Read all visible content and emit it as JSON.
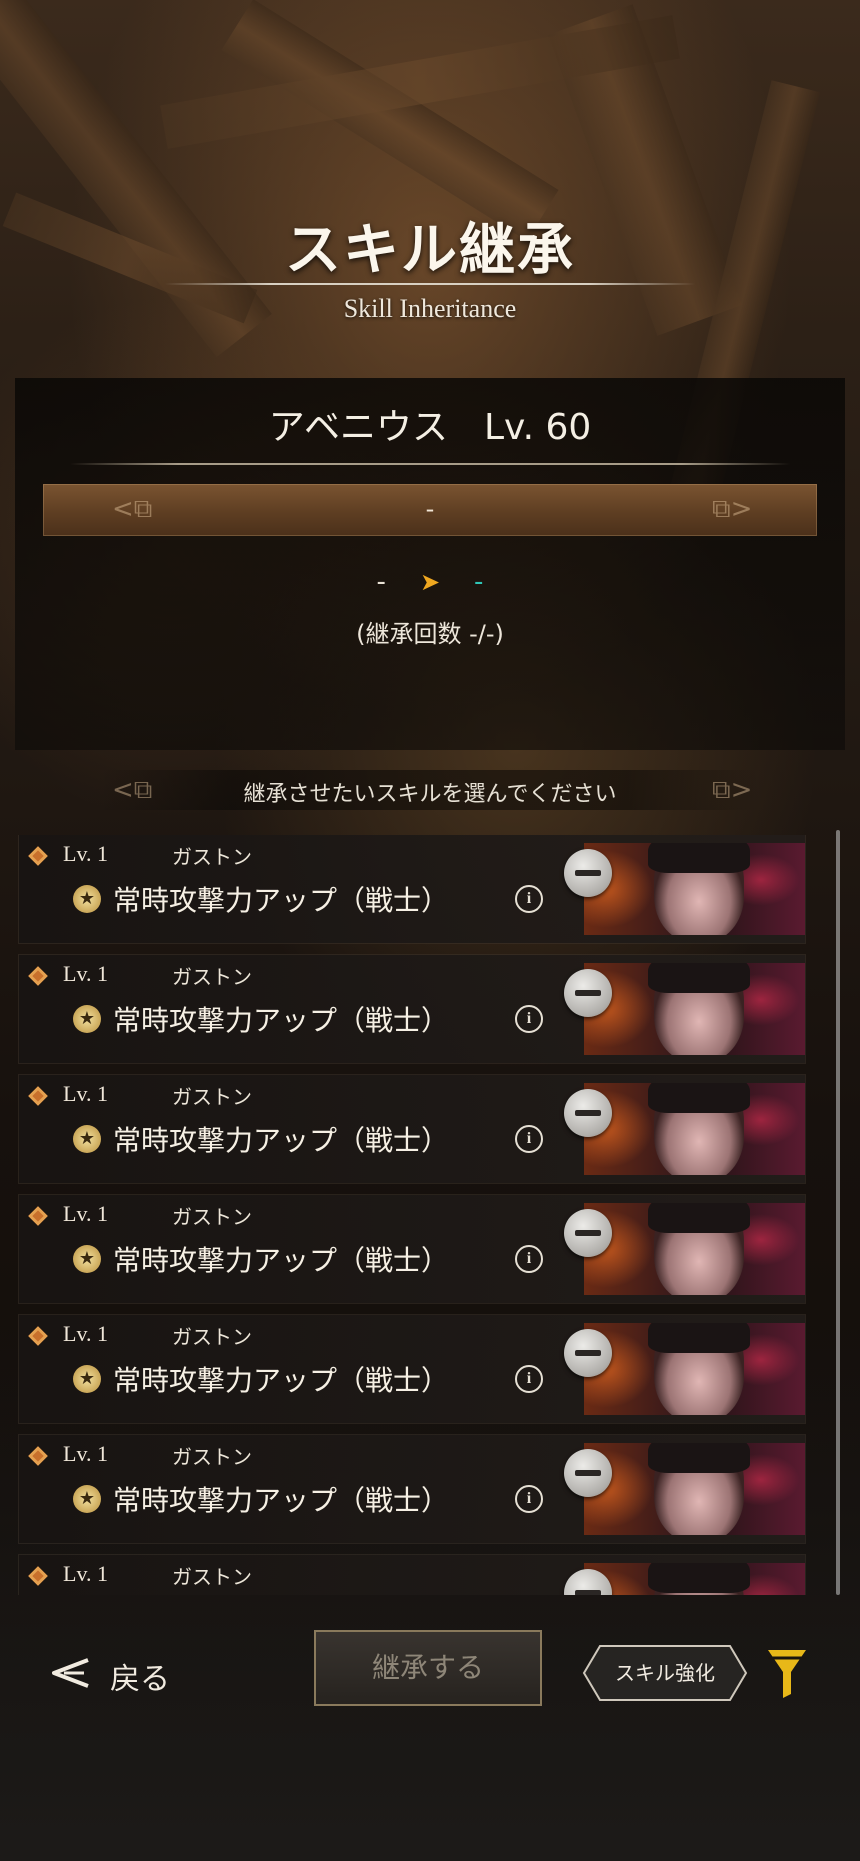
{
  "header": {
    "title": "スキル継承",
    "subtitle": "Skill Inheritance"
  },
  "character": {
    "name_level": "アベニウス　Lv. 60",
    "selected_skill": "-",
    "transfer_from": "-",
    "transfer_to": "-",
    "count": "(継承回数 -/-)"
  },
  "instruction": "継承させたいスキルを選んでください",
  "skills": [
    {
      "level": "Lv. 1",
      "owner": "ガストン",
      "name": "常時攻撃力アップ（戦士）"
    },
    {
      "level": "Lv. 1",
      "owner": "ガストン",
      "name": "常時攻撃力アップ（戦士）"
    },
    {
      "level": "Lv. 1",
      "owner": "ガストン",
      "name": "常時攻撃力アップ（戦士）"
    },
    {
      "level": "Lv. 1",
      "owner": "ガストン",
      "name": "常時攻撃力アップ（戦士）"
    },
    {
      "level": "Lv. 1",
      "owner": "ガストン",
      "name": "常時攻撃力アップ（戦士）"
    },
    {
      "level": "Lv. 1",
      "owner": "ガストン",
      "name": "常時攻撃力アップ（戦士）"
    },
    {
      "level": "Lv. 1",
      "owner": "ガストン",
      "name": ""
    }
  ],
  "footer": {
    "back_label": "戻る",
    "inherit_label": "継承する",
    "enhance_label": "スキル強化"
  },
  "colors": {
    "accent_gold": "#f0a820",
    "accent_teal": "#2fc6b6",
    "filter_yellow": "#e8b818"
  },
  "icons": [
    "back-arrow-icon",
    "star-icon",
    "info-icon",
    "minus-icon",
    "filter-icon",
    "ornament-icon"
  ]
}
